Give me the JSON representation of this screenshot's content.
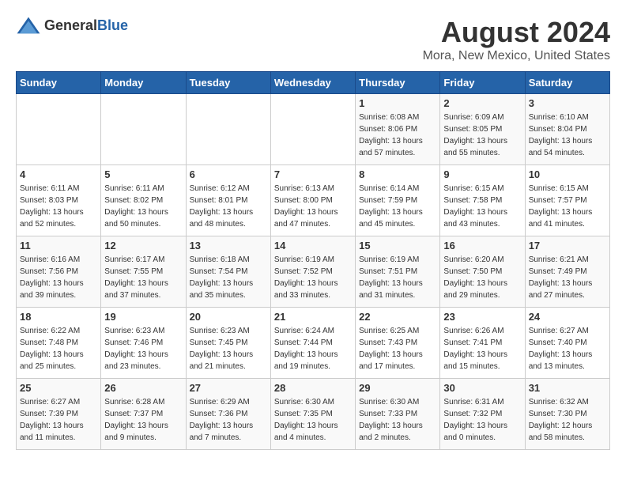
{
  "header": {
    "logo_general": "General",
    "logo_blue": "Blue",
    "month_title": "August 2024",
    "location": "Mora, New Mexico, United States"
  },
  "days_of_week": [
    "Sunday",
    "Monday",
    "Tuesday",
    "Wednesday",
    "Thursday",
    "Friday",
    "Saturday"
  ],
  "weeks": [
    [
      {
        "day": "",
        "info": ""
      },
      {
        "day": "",
        "info": ""
      },
      {
        "day": "",
        "info": ""
      },
      {
        "day": "",
        "info": ""
      },
      {
        "day": "1",
        "info": "Sunrise: 6:08 AM\nSunset: 8:06 PM\nDaylight: 13 hours\nand 57 minutes."
      },
      {
        "day": "2",
        "info": "Sunrise: 6:09 AM\nSunset: 8:05 PM\nDaylight: 13 hours\nand 55 minutes."
      },
      {
        "day": "3",
        "info": "Sunrise: 6:10 AM\nSunset: 8:04 PM\nDaylight: 13 hours\nand 54 minutes."
      }
    ],
    [
      {
        "day": "4",
        "info": "Sunrise: 6:11 AM\nSunset: 8:03 PM\nDaylight: 13 hours\nand 52 minutes."
      },
      {
        "day": "5",
        "info": "Sunrise: 6:11 AM\nSunset: 8:02 PM\nDaylight: 13 hours\nand 50 minutes."
      },
      {
        "day": "6",
        "info": "Sunrise: 6:12 AM\nSunset: 8:01 PM\nDaylight: 13 hours\nand 48 minutes."
      },
      {
        "day": "7",
        "info": "Sunrise: 6:13 AM\nSunset: 8:00 PM\nDaylight: 13 hours\nand 47 minutes."
      },
      {
        "day": "8",
        "info": "Sunrise: 6:14 AM\nSunset: 7:59 PM\nDaylight: 13 hours\nand 45 minutes."
      },
      {
        "day": "9",
        "info": "Sunrise: 6:15 AM\nSunset: 7:58 PM\nDaylight: 13 hours\nand 43 minutes."
      },
      {
        "day": "10",
        "info": "Sunrise: 6:15 AM\nSunset: 7:57 PM\nDaylight: 13 hours\nand 41 minutes."
      }
    ],
    [
      {
        "day": "11",
        "info": "Sunrise: 6:16 AM\nSunset: 7:56 PM\nDaylight: 13 hours\nand 39 minutes."
      },
      {
        "day": "12",
        "info": "Sunrise: 6:17 AM\nSunset: 7:55 PM\nDaylight: 13 hours\nand 37 minutes."
      },
      {
        "day": "13",
        "info": "Sunrise: 6:18 AM\nSunset: 7:54 PM\nDaylight: 13 hours\nand 35 minutes."
      },
      {
        "day": "14",
        "info": "Sunrise: 6:19 AM\nSunset: 7:52 PM\nDaylight: 13 hours\nand 33 minutes."
      },
      {
        "day": "15",
        "info": "Sunrise: 6:19 AM\nSunset: 7:51 PM\nDaylight: 13 hours\nand 31 minutes."
      },
      {
        "day": "16",
        "info": "Sunrise: 6:20 AM\nSunset: 7:50 PM\nDaylight: 13 hours\nand 29 minutes."
      },
      {
        "day": "17",
        "info": "Sunrise: 6:21 AM\nSunset: 7:49 PM\nDaylight: 13 hours\nand 27 minutes."
      }
    ],
    [
      {
        "day": "18",
        "info": "Sunrise: 6:22 AM\nSunset: 7:48 PM\nDaylight: 13 hours\nand 25 minutes."
      },
      {
        "day": "19",
        "info": "Sunrise: 6:23 AM\nSunset: 7:46 PM\nDaylight: 13 hours\nand 23 minutes."
      },
      {
        "day": "20",
        "info": "Sunrise: 6:23 AM\nSunset: 7:45 PM\nDaylight: 13 hours\nand 21 minutes."
      },
      {
        "day": "21",
        "info": "Sunrise: 6:24 AM\nSunset: 7:44 PM\nDaylight: 13 hours\nand 19 minutes."
      },
      {
        "day": "22",
        "info": "Sunrise: 6:25 AM\nSunset: 7:43 PM\nDaylight: 13 hours\nand 17 minutes."
      },
      {
        "day": "23",
        "info": "Sunrise: 6:26 AM\nSunset: 7:41 PM\nDaylight: 13 hours\nand 15 minutes."
      },
      {
        "day": "24",
        "info": "Sunrise: 6:27 AM\nSunset: 7:40 PM\nDaylight: 13 hours\nand 13 minutes."
      }
    ],
    [
      {
        "day": "25",
        "info": "Sunrise: 6:27 AM\nSunset: 7:39 PM\nDaylight: 13 hours\nand 11 minutes."
      },
      {
        "day": "26",
        "info": "Sunrise: 6:28 AM\nSunset: 7:37 PM\nDaylight: 13 hours\nand 9 minutes."
      },
      {
        "day": "27",
        "info": "Sunrise: 6:29 AM\nSunset: 7:36 PM\nDaylight: 13 hours\nand 7 minutes."
      },
      {
        "day": "28",
        "info": "Sunrise: 6:30 AM\nSunset: 7:35 PM\nDaylight: 13 hours\nand 4 minutes."
      },
      {
        "day": "29",
        "info": "Sunrise: 6:30 AM\nSunset: 7:33 PM\nDaylight: 13 hours\nand 2 minutes."
      },
      {
        "day": "30",
        "info": "Sunrise: 6:31 AM\nSunset: 7:32 PM\nDaylight: 13 hours\nand 0 minutes."
      },
      {
        "day": "31",
        "info": "Sunrise: 6:32 AM\nSunset: 7:30 PM\nDaylight: 12 hours\nand 58 minutes."
      }
    ]
  ]
}
